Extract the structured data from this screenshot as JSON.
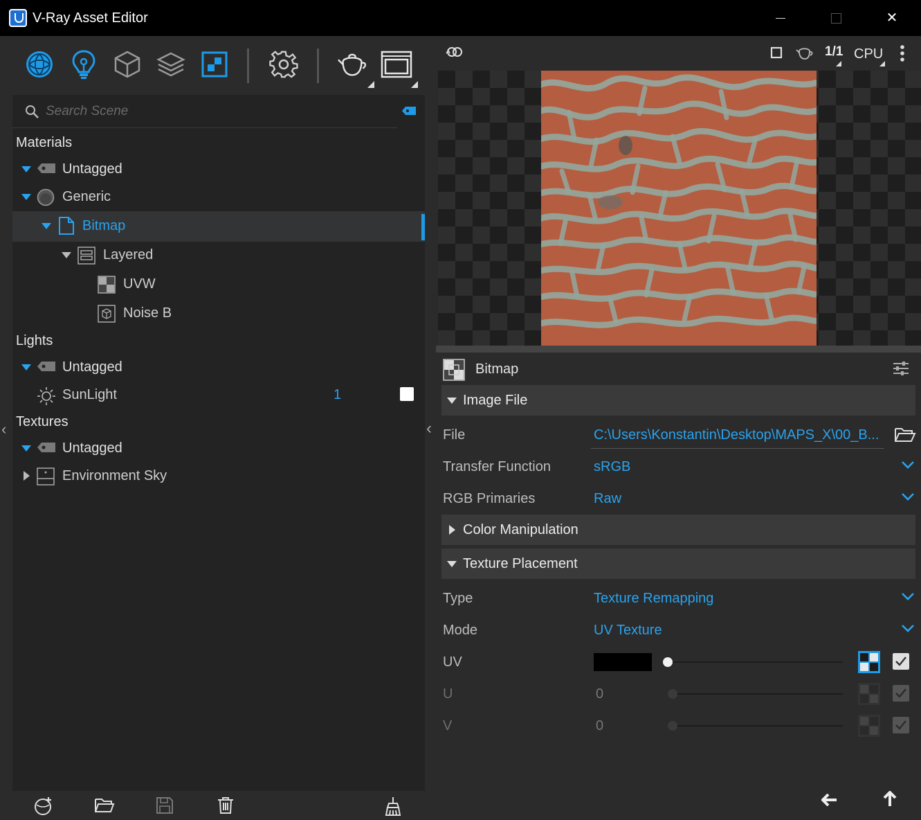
{
  "window": {
    "title": "V-Ray Asset Editor",
    "close_glyph": "✕"
  },
  "toolbar": {
    "icons": [
      "materials-icon",
      "lights-icon",
      "geometry-icon",
      "render-elements-icon",
      "textures-icon",
      "settings-icon",
      "render-interactive-icon",
      "frame-buffer-icon"
    ]
  },
  "search": {
    "placeholder": "Search Scene",
    "value": ""
  },
  "tree": {
    "materials": {
      "heading": "Materials",
      "untagged": "Untagged",
      "generic": "Generic",
      "bitmap": "Bitmap",
      "layered": "Layered",
      "uvw": "UVW",
      "noise": "Noise B"
    },
    "lights": {
      "heading": "Lights",
      "untagged": "Untagged",
      "sunlight": "SunLight",
      "sunlight_count": "1"
    },
    "textures": {
      "heading": "Textures",
      "untagged": "Untagged",
      "env_sky": "Environment Sky"
    }
  },
  "preview": {
    "resolution_label": "1/1",
    "engine": "CPU"
  },
  "props": {
    "title": "Bitmap",
    "image_file": {
      "heading": "Image File",
      "file_label": "File",
      "file_value": "C:\\Users\\Konstantin\\Desktop\\MAPS_X\\00_B...",
      "transfer_label": "Transfer Function",
      "transfer_value": "sRGB",
      "primaries_label": "RGB Primaries",
      "primaries_value": "Raw"
    },
    "color_manipulation": {
      "heading": "Color Manipulation"
    },
    "texture_placement": {
      "heading": "Texture Placement",
      "type_label": "Type",
      "type_value": "Texture Remapping",
      "mode_label": "Mode",
      "mode_value": "UV Texture",
      "uv_label": "UV",
      "u_label": "U",
      "u_value": "0",
      "v_label": "V",
      "v_value": "0"
    }
  },
  "colors": {
    "accent": "#2aa3ee",
    "background": "#2b2b2b",
    "tree_background": "#232323",
    "titlebar": "#000000"
  }
}
